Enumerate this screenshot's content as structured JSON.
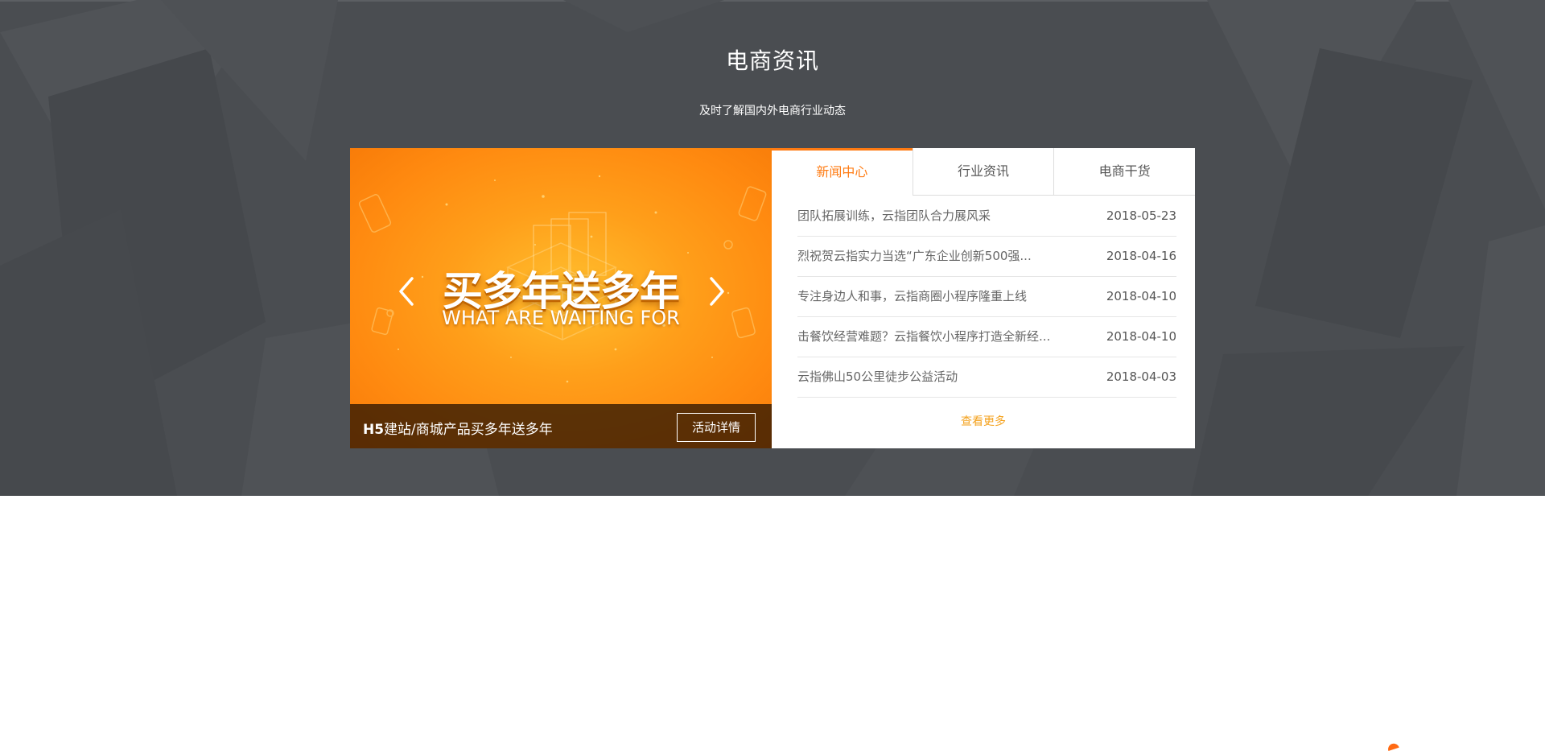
{
  "section": {
    "title": "电商资讯",
    "subtitle": "及时了解国内外电商行业动态"
  },
  "banner": {
    "headline": "买多年送多年",
    "subheadline": "WHAT ARE WAITING FOR",
    "caption_prefix": "H5",
    "caption_rest": "建站/商城产品买多年送多年",
    "button_label": "活动详情"
  },
  "tabs": [
    {
      "label": "新闻中心",
      "active": true
    },
    {
      "label": "行业资讯",
      "active": false
    },
    {
      "label": "电商干货",
      "active": false
    }
  ],
  "news": [
    {
      "title": "团队拓展训练，云指团队合力展风采",
      "date": "2018-05-23"
    },
    {
      "title": "烈祝贺云指实力当选“广东企业创新500强...",
      "date": "2018-04-16"
    },
    {
      "title": "专注身边人和事，云指商圈小程序隆重上线",
      "date": "2018-04-10"
    },
    {
      "title": "击餐饮经营难题？云指餐饮小程序打造全新经...",
      "date": "2018-04-10"
    },
    {
      "title": "云指佛山50公里徒步公益活动",
      "date": "2018-04-03"
    }
  ],
  "more_label": "查看更多",
  "icons": {
    "prev": "chevron-left-icon",
    "next": "chevron-right-icon"
  },
  "colors": {
    "section_background": "#4a4d51",
    "accent": "#ff7b12",
    "more_link": "#f4a21e",
    "banner_orange": "#ff9f1a"
  }
}
